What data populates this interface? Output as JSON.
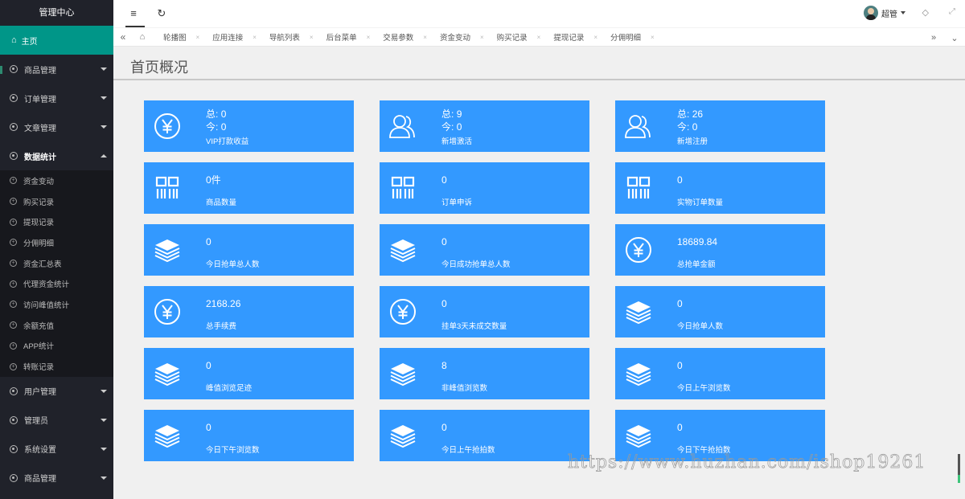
{
  "sidebar": {
    "title": "管理中心",
    "home": "主页",
    "menus_top": [
      {
        "label": "商品管理",
        "open": false
      },
      {
        "label": "订单管理",
        "open": false
      },
      {
        "label": "文章管理",
        "open": false
      },
      {
        "label": "数据统计",
        "open": true
      }
    ],
    "sub_items": [
      "资金变动",
      "购买记录",
      "提现记录",
      "分佣明细",
      "资金汇总表",
      "代理资金统计",
      "访问峰值统计",
      "余额充值",
      "APP统计",
      "转账记录"
    ],
    "menus_bottom": [
      {
        "label": "用户管理"
      },
      {
        "label": "管理员"
      },
      {
        "label": "系统设置"
      },
      {
        "label": "商品管理"
      }
    ]
  },
  "header": {
    "user_name": "超管",
    "icons": {
      "menu": "≡",
      "refresh": "↻",
      "tag": "◇",
      "fullscreen": "⤢"
    }
  },
  "tabs": {
    "items": [
      "轮播图",
      "应用连接",
      "导航列表",
      "后台菜单",
      "交易参数",
      "资金变动",
      "购买记录",
      "提现记录",
      "分佣明细"
    ],
    "left_arrow": "«",
    "right_arrow": "»",
    "dropdown": "⌄",
    "home": "⌂",
    "close": "×"
  },
  "page": {
    "title": "首页概况"
  },
  "cards": [
    {
      "icon": "yen",
      "total_label": "总:",
      "total": "0",
      "today_label": "今:",
      "today": "0",
      "label": "VIP打款收益"
    },
    {
      "icon": "users",
      "total_label": "总:",
      "total": "9",
      "today_label": "今:",
      "today": "0",
      "label": "新增激活"
    },
    {
      "icon": "users",
      "total_label": "总:",
      "total": "26",
      "today_label": "今:",
      "today": "0",
      "label": "新增注册"
    },
    {
      "icon": "grid",
      "value": "0件",
      "label": "商品数量"
    },
    {
      "icon": "grid",
      "value": "0",
      "label": "订单申诉"
    },
    {
      "icon": "grid",
      "value": "0",
      "label": "实物订单数量"
    },
    {
      "icon": "layers",
      "value": "0",
      "label": "今日抢单总人数"
    },
    {
      "icon": "layers",
      "value": "0",
      "label": "今日成功抢单总人数"
    },
    {
      "icon": "yen",
      "value": "18689.84",
      "label": "总抢单金额"
    },
    {
      "icon": "yen",
      "value": "2168.26",
      "label": "总手续费"
    },
    {
      "icon": "yen",
      "value": "0",
      "label": "挂单3天未成交数量"
    },
    {
      "icon": "layers",
      "value": "0",
      "label": "今日抢单人数"
    },
    {
      "icon": "layers",
      "value": "0",
      "label": "峰值浏览足迹"
    },
    {
      "icon": "layers",
      "value": "8",
      "label": "非峰值浏览数"
    },
    {
      "icon": "layers",
      "value": "0",
      "label": "今日上午浏览数"
    },
    {
      "icon": "layers",
      "value": "0",
      "label": "今日下午浏览数"
    },
    {
      "icon": "layers",
      "value": "0",
      "label": "今日上午抢拍数"
    },
    {
      "icon": "layers",
      "value": "0",
      "label": "今日下午抢拍数"
    }
  ],
  "watermark": "https://www.huzhan.com/ishop19261",
  "colors": {
    "sidebar_bg": "#20222a",
    "active_green": "#009688",
    "card_blue": "#3399ff"
  }
}
